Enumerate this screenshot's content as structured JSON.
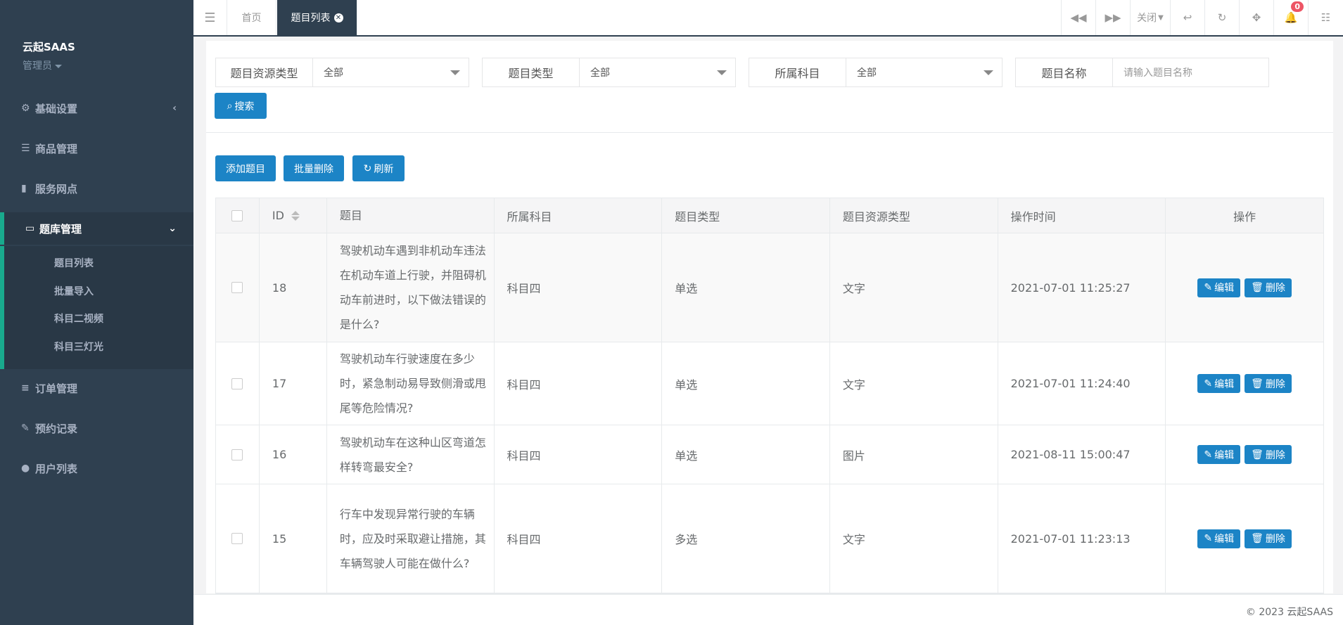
{
  "sidebar": {
    "brand": "云起SAAS",
    "role": "管理员",
    "items": [
      {
        "label": "基础设置",
        "icon": "gear-icon",
        "arrow": "‹"
      },
      {
        "label": "商品管理",
        "icon": "list-icon"
      },
      {
        "label": "服务网点",
        "icon": "book-icon"
      },
      {
        "label": "题库管理",
        "icon": "monitor-icon",
        "arrow": "⌄"
      },
      {
        "label": "订单管理",
        "icon": "bars-icon"
      },
      {
        "label": "预约记录",
        "icon": "pencil-icon"
      },
      {
        "label": "用户列表",
        "icon": "user-icon"
      }
    ],
    "subitems": [
      "题目列表",
      "批量导入",
      "科目二视频",
      "科目三灯光"
    ]
  },
  "topbar": {
    "tabs": [
      "首页",
      "题目列表"
    ],
    "close_label": "关闭",
    "notification_count": "0"
  },
  "search": {
    "resource_type": {
      "label": "题目资源类型",
      "value": "全部"
    },
    "question_type": {
      "label": "题目类型",
      "value": "全部"
    },
    "subject": {
      "label": "所属科目",
      "value": "全部"
    },
    "name": {
      "label": "题目名称",
      "placeholder": "请输入题目名称"
    },
    "search_button": "搜索"
  },
  "toolbar": {
    "add": "添加题目",
    "batch_delete": "批量删除",
    "refresh": "刷新"
  },
  "table": {
    "headers": [
      "ID",
      "题目",
      "所属科目",
      "题目类型",
      "题目资源类型",
      "操作时间",
      "操作"
    ],
    "rows": [
      {
        "id": "18",
        "question": "驾驶机动车遇到非机动车违法在机动车道上行驶，并阻碍机动车前进时，以下做法错误的是什么?",
        "subject": "科目四",
        "type": "单选",
        "resource": "文字",
        "time": "2021-07-01 11:25:27"
      },
      {
        "id": "17",
        "question": "驾驶机动车行驶速度在多少时，紧急制动易导致侧滑或甩尾等危险情况?",
        "subject": "科目四",
        "type": "单选",
        "resource": "文字",
        "time": "2021-07-01 11:24:40"
      },
      {
        "id": "16",
        "question": "驾驶机动车在这种山区弯道怎样转弯最安全?",
        "subject": "科目四",
        "type": "单选",
        "resource": "图片",
        "time": "2021-08-11 15:00:47"
      },
      {
        "id": "15",
        "question": "行车中发现异常行驶的车辆时，应及时采取避让措施，其车辆驾驶人可能在做什么?",
        "subject": "科目四",
        "type": "多选",
        "resource": "文字",
        "time": "2021-07-01 11:23:13"
      }
    ],
    "edit_label": "编辑",
    "delete_label": "删除"
  },
  "footer": {
    "copyright": "© 2023 云起SAAS"
  }
}
